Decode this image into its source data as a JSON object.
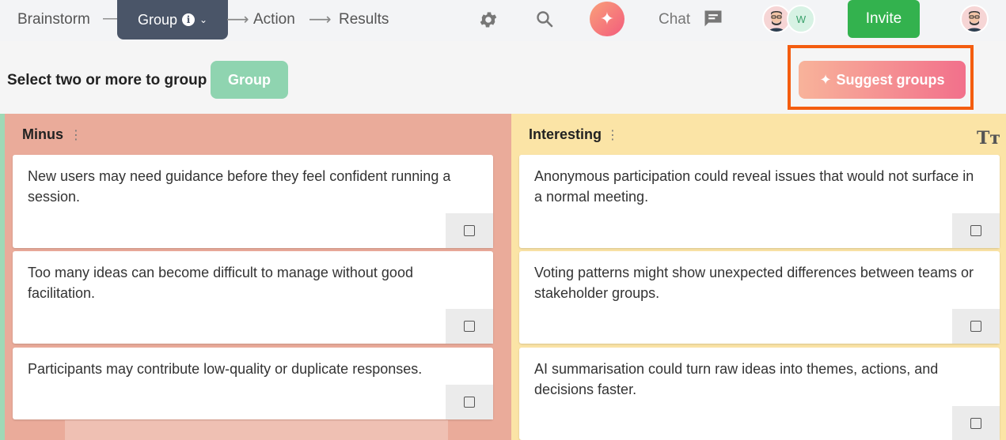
{
  "nav": {
    "steps": [
      "Brainstorm",
      "Group",
      "Action",
      "Results"
    ],
    "active_step": "Group",
    "chat_label": "Chat",
    "invite_label": "Invite",
    "avatar_w_initial": "W"
  },
  "toolbar": {
    "select_prompt": "Select two or more to group",
    "group_button": "Group",
    "suggest_button": "Suggest groups"
  },
  "columns": [
    {
      "title": "Minus",
      "color": "#eaab9a",
      "cards": [
        "New users may need guidance before they feel confident running a session.",
        "Too many ideas can become difficult to manage without good facilitation.",
        "Participants may contribute low-quality or duplicate responses."
      ]
    },
    {
      "title": "Interesting",
      "color": "#fbe4a6",
      "cards": [
        "Anonymous participation could reveal issues that would not surface in a normal meeting.",
        "Voting patterns might show unexpected differences between teams or stakeholder groups.",
        "AI summarisation could turn raw ideas into themes, actions, and decisions faster."
      ]
    }
  ],
  "colors": {
    "invite": "#33b24e",
    "active_step": "#4a5568",
    "highlight_frame": "#f45d0f"
  }
}
